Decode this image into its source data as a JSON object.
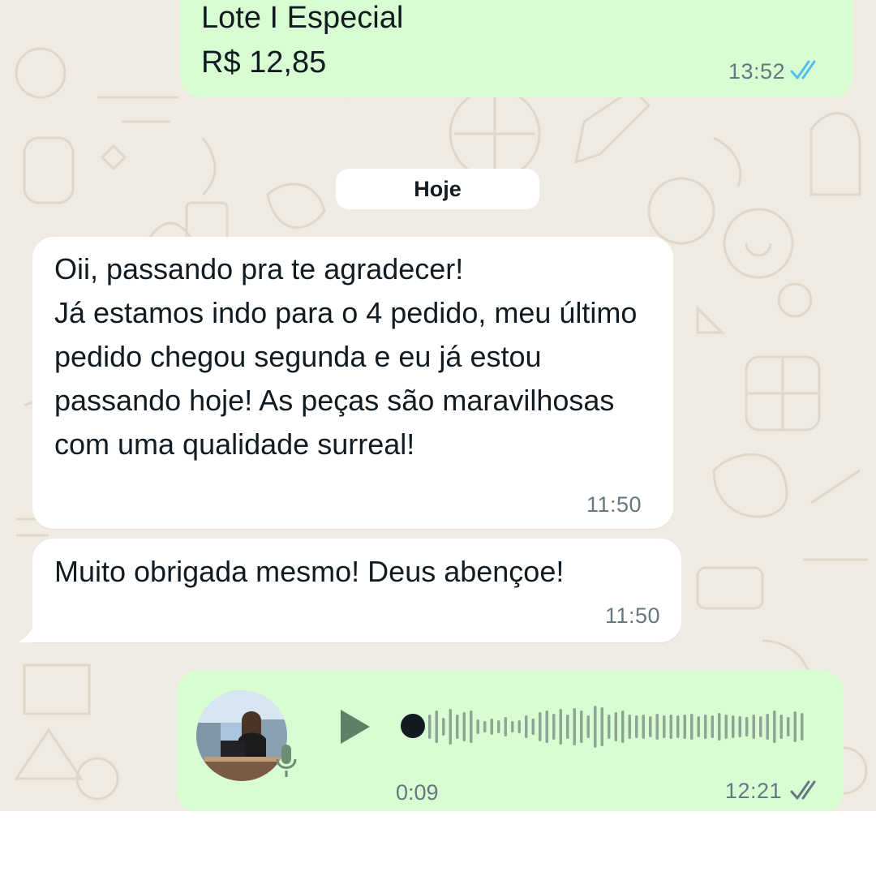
{
  "chat": {
    "previous_message": {
      "line1": "Lote I Especial",
      "line2": "R$ 12,85",
      "time": "13:52",
      "status": "read"
    },
    "date_divider": "Hoje",
    "incoming_messages": [
      {
        "text": "Oii, passando pra te agradecer!\nJá estamos indo para o 4 pedido, meu último pedido chegou segunda e eu já estou passando hoje! As peças são maravilhosas com uma qualidade surreal!",
        "time": "11:50"
      },
      {
        "text": "Muito obrigada mesmo! Deus abençoe!",
        "time": "11:50"
      }
    ],
    "voice_message": {
      "duration": "0:09",
      "time": "12:21",
      "status": "delivered",
      "progress": 0
    }
  },
  "icons": {
    "read_ticks": "double-check-blue-icon",
    "delivered_ticks": "double-check-gray-icon",
    "play": "play-icon",
    "mic": "microphone-icon"
  },
  "colors": {
    "outgoing_bubble": "#d9fdd3",
    "incoming_bubble": "#ffffff",
    "chat_background": "#efeae2",
    "read_tick": "#53bdeb",
    "meta_text": "#667781",
    "waveform": "#8fa593"
  }
}
